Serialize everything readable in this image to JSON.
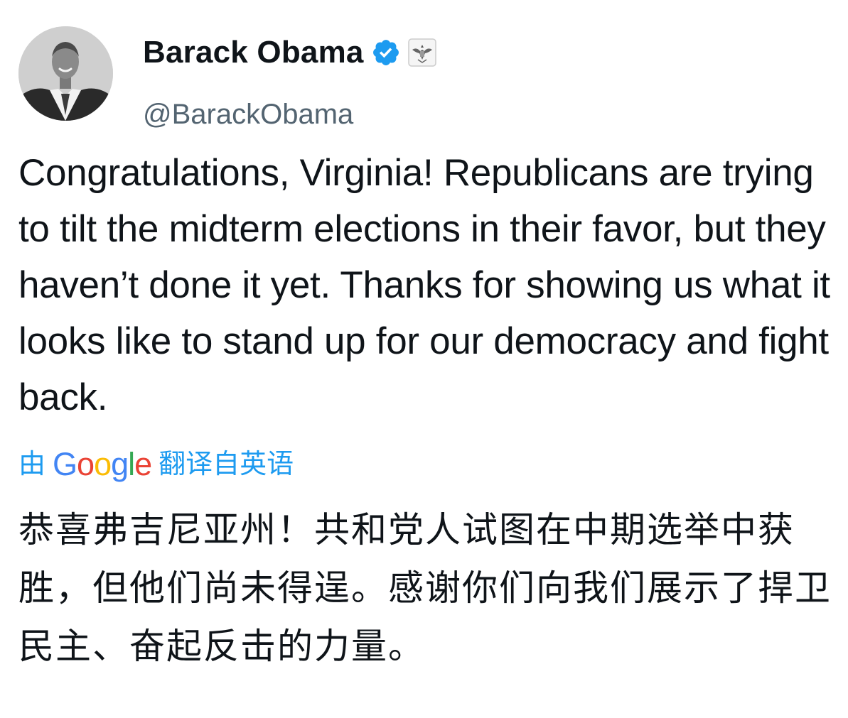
{
  "author": {
    "display_name": "Barack Obama",
    "handle": "@BarackObama",
    "verified": true,
    "affiliate_badge": "us-seal-badge",
    "avatar_icon": "profile-photo-avatar"
  },
  "tweet": {
    "text": "Congratulations, Virginia! Republicans are trying to tilt the midterm elections in their favor, but they haven’t done it yet. Thanks for showing us what it looks like to stand up for our democracy and fight back."
  },
  "translation": {
    "prefix": "由",
    "provider": "Google",
    "suffix": "翻译自英语",
    "text": "恭喜弗吉尼亚州！共和党人试图在中期选举中获胜，但他们尚未得逞。感谢你们向我们展示了捍卫民主、奋起反击的力量。"
  },
  "colors": {
    "text_primary": "#0f1419",
    "text_secondary": "#536471",
    "link_blue": "#1d9bf0",
    "verified_blue": "#1d9bf0"
  }
}
